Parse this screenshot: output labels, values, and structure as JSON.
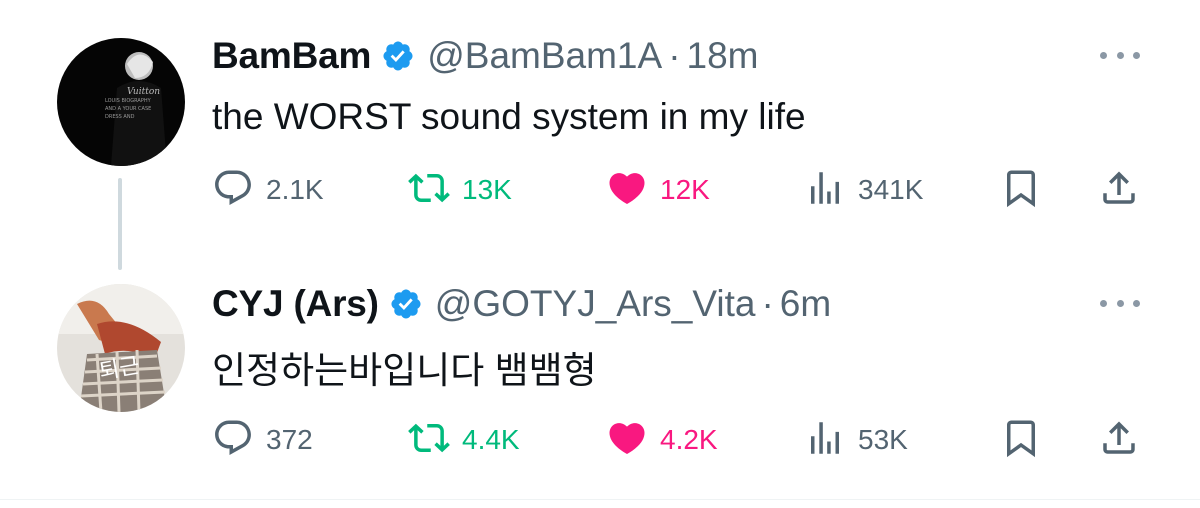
{
  "tweets": [
    {
      "name": "BamBam",
      "handle": "@BamBam1A",
      "separator": "·",
      "time": "18m",
      "text": "the WORST sound system in my life",
      "replies": "2.1K",
      "retweets": "13K",
      "likes": "12K",
      "views": "341K",
      "liked": true,
      "verified": true
    },
    {
      "name": "CYJ (Ars)",
      "handle": "@GOTYJ_Ars_Vita",
      "separator": "·",
      "time": "6m",
      "text": "인정하는바입니다 뱀뱀형",
      "replies": "372",
      "retweets": "4.4K",
      "likes": "4.2K",
      "views": "53K",
      "liked": true,
      "verified": true
    }
  ],
  "icons": {
    "verified": "verified-badge-icon",
    "reply": "reply-icon",
    "retweet": "retweet-icon",
    "like": "heart-icon",
    "views": "views-icon",
    "bookmark": "bookmark-icon",
    "share": "share-icon",
    "more": "more-icon"
  },
  "colors": {
    "verified": "#1d9bf0",
    "retweet": "#00ba7c",
    "like": "#f91880",
    "muted": "#536471"
  }
}
